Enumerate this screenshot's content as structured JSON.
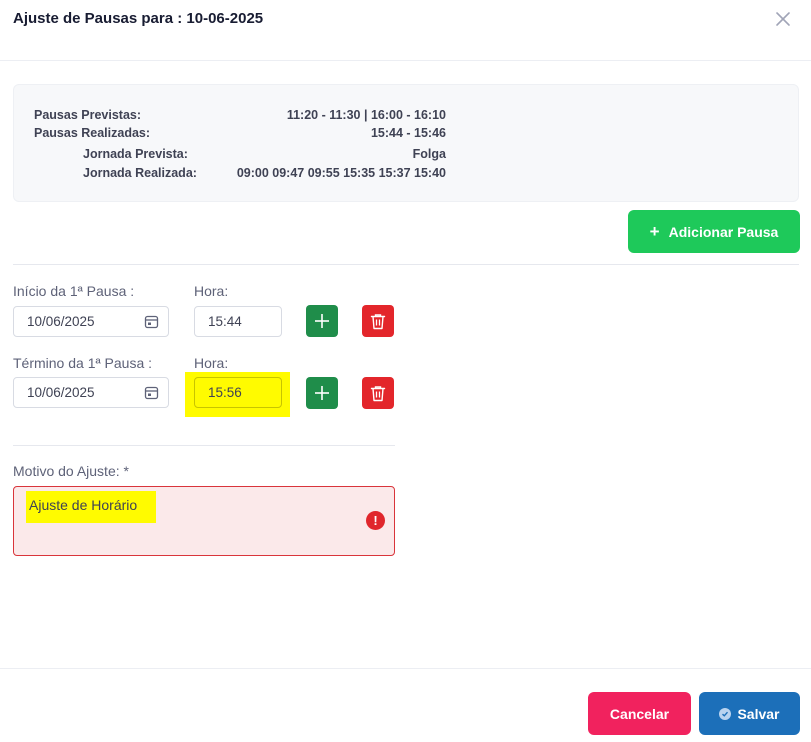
{
  "modal": {
    "title": "Ajuste de Pausas para : 10-06-2025",
    "close_icon": "close-icon"
  },
  "summary": {
    "pausas_previstas_label": "Pausas Previstas:",
    "pausas_previstas_value": "11:20 - 11:30 | 16:00 - 16:10",
    "pausas_realizadas_label": "Pausas Realizadas:",
    "pausas_realizadas_value": "15:44 - 15:46",
    "jornada_prevista_label": "Jornada Prevista:",
    "jornada_prevista_value": "Folga",
    "jornada_realizada_label": "Jornada Realizada:",
    "jornada_realizada_value": "09:00 09:47 09:55 15:35 15:37 15:40"
  },
  "add_pause_button": {
    "label": "Adicionar Pausa",
    "icon": "plus-icon"
  },
  "pause_start": {
    "label": "Início da 1ª Pausa :",
    "date": "10/06/2025",
    "hour_label": "Hora:",
    "hour": "15:44"
  },
  "pause_end": {
    "label": "Término da 1ª Pausa :",
    "date": "10/06/2025",
    "hour_label": "Hora:",
    "hour": "15:56"
  },
  "reason": {
    "label": "Motivo do Ajuste: *",
    "value": "Ajuste de Horário",
    "error_icon": "!"
  },
  "footer": {
    "cancel_label": "Cancelar",
    "save_label": "Salvar"
  },
  "colors": {
    "add_button": "#1ec95a",
    "add_row_button": "#1f8d4a",
    "delete_button": "#e3262b",
    "cancel_button": "#f1225e",
    "save_button": "#1c6fb9",
    "highlight": "#fffb00",
    "error_border": "#d9353b"
  }
}
